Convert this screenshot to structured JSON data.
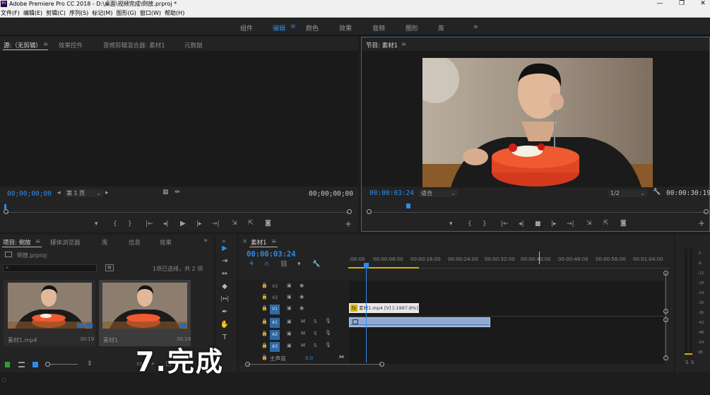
{
  "titlebar": {
    "logo": "Pr",
    "title": "Adobe Premiere Pro CC 2018 - D:\\桌面\\视频完成\\倒放.prproj *",
    "min": "—",
    "max": "❐",
    "close": "✕"
  },
  "menubar": [
    "文件(F)",
    "编辑(E)",
    "剪辑(C)",
    "序列(S)",
    "标记(M)",
    "图形(G)",
    "窗口(W)",
    "帮助(H)"
  ],
  "workspaces": {
    "items": [
      "组件",
      "编辑",
      "颜色",
      "效果",
      "音频",
      "图形",
      "库"
    ],
    "active": "编辑",
    "menu_glyph": "≡",
    "more": "»"
  },
  "source_panel": {
    "tabs": [
      "源:（无剪辑）",
      "效果控件",
      "音频剪辑混合器: 素材1",
      "元数据"
    ],
    "tab_menu": "≡",
    "timecode_left": "00;00;00;00",
    "page": "第 1 页",
    "timecode_right": "00;00;00;00"
  },
  "program_panel": {
    "tab": "节目: 素材1",
    "tab_menu": "≡",
    "timecode_left": "00:00:03:24",
    "fit": "适合",
    "resolution": "1/2",
    "timecode_right": "00:00:30:19"
  },
  "transport": {
    "marker": "▾",
    "in": "{",
    "out": "}",
    "go_in": "|←",
    "step_back": "◂|",
    "play": "▶",
    "stop": "■",
    "step_fwd": "|▸",
    "go_out": "→|",
    "lift": "⇲",
    "extract": "⇱",
    "export": "◙",
    "add": "+"
  },
  "project_panel": {
    "tabs": [
      "项目: 倒放",
      "媒体浏览器",
      "库",
      "信息",
      "效果"
    ],
    "tab_menu": "≡",
    "more": "»",
    "project_file": "倒放.prproj",
    "selection_status": "1项已选择，共 2 项",
    "items": [
      {
        "name": "素材1.mp4",
        "duration": "30:19"
      },
      {
        "name": "素材1",
        "duration": "30:19"
      }
    ]
  },
  "tools": [
    "▶",
    "⇥",
    "⇔",
    "◆",
    "|↔|",
    "✒",
    "✋",
    "T"
  ],
  "timeline": {
    "close": "×",
    "sequence_tab": "素材1",
    "tab_menu": "≡",
    "timecode": "00:00:03:24",
    "ruler_labels": [
      ":00:00",
      "00:00:08:00",
      "00:00:16:00",
      "00:00:24:00",
      "00:00:32:00",
      "00:00:40:00",
      "00:00:48:00",
      "00:00:56:00",
      "00:01:04:00"
    ],
    "video_tracks": [
      "V3",
      "V2",
      "V1"
    ],
    "audio_tracks": [
      "A1",
      "A2",
      "A3"
    ],
    "master": "主声道",
    "master_value": "0.0",
    "clip_video": "素材1.mp4 [V] [-1997.8%]",
    "fx_label": "fx",
    "mute": "M",
    "solo": "S",
    "overlay_caption": "7.完成"
  },
  "vu_meter": {
    "labels": [
      "0",
      "-6",
      "-12",
      "-18",
      "-24",
      "-30",
      "-36",
      "-42",
      "-48",
      "-54",
      "dB"
    ],
    "solo_buttons": [
      "S",
      "S"
    ]
  },
  "colors": {
    "accent": "#2d8ceb",
    "audio_clip": "#8fa9d4",
    "video_clip": "#e8e8e8",
    "work_area": "#d6b000"
  }
}
